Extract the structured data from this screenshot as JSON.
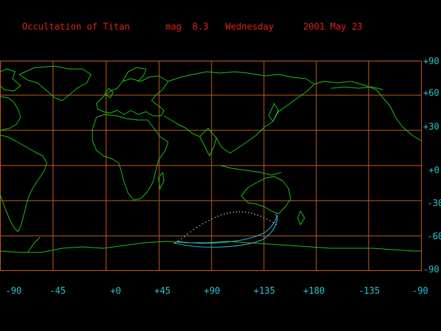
{
  "header": {
    "title": "Occultation of Titan",
    "magnitude": "mag  8.3",
    "weekday": "Wednesday",
    "date": "2001 May 23"
  },
  "map": {
    "grid_color": "#c8641e",
    "coast_color": "#1ec81e",
    "path_color": "#3cb4e6",
    "dots_color": "#ffffff",
    "lon_labels": [
      "-90",
      "-45",
      "+0",
      "+45",
      "+90",
      "+135",
      "+180",
      "-135",
      "-90"
    ],
    "lat_labels": [
      "+90",
      "+60",
      "+30",
      "+0",
      "-30",
      "-60",
      "-90"
    ]
  }
}
